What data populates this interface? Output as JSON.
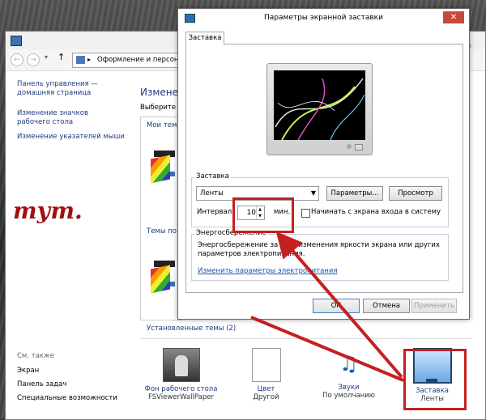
{
  "back_window": {
    "address": "Оформление и персона…",
    "left_nav": {
      "home_link": "Панель управления — домашняя страница",
      "link_icons": "Изменение значков рабочего стола",
      "link_pointers": "Изменение указателей мыши",
      "see_also": "См. также",
      "items": [
        "Экран",
        "Панель задач",
        "Специальные возможности"
      ]
    },
    "annotation_text": "тут.",
    "main": {
      "heading": "Изменен",
      "subheading": "Выберите т",
      "my_themes": "Мои темы",
      "default_themes": "Темы по",
      "installed_themes": "Установленные темы (2)"
    },
    "bottom": [
      {
        "title": "Фон рабочего стола",
        "sub": "FSViewerWallPaper",
        "icon": "wallpaper-icon"
      },
      {
        "title": "Цвет",
        "sub": "Другой",
        "icon": "color-icon"
      },
      {
        "title": "Звуки",
        "sub": "По умолчанию",
        "icon": "sounds-icon"
      },
      {
        "title": "Заставка",
        "sub": "Ленты",
        "icon": "screensaver-icon"
      }
    ]
  },
  "dialog": {
    "title": "Параметры экранной заставки",
    "close_symbol": "✕",
    "tab": "Заставка",
    "screensaver_group": "Заставка",
    "screensaver_value": "Ленты",
    "params_button": "Параметры...",
    "preview_button": "Просмотр",
    "interval_label": "Интервал:",
    "interval_value": "10",
    "interval_unit": "мин.",
    "logon_checkbox": "Начинать с экрана входа в систему",
    "power_group": "Энергосбережение",
    "power_text": "Энергосбережение за счет изменения яркости экрана или других параметров электропитания.",
    "power_link": "Изменить параметры электропитания",
    "ok": "ОК",
    "cancel": "Отмена",
    "apply": "Применить"
  },
  "colors": {
    "annotation_red": "#c42020"
  }
}
